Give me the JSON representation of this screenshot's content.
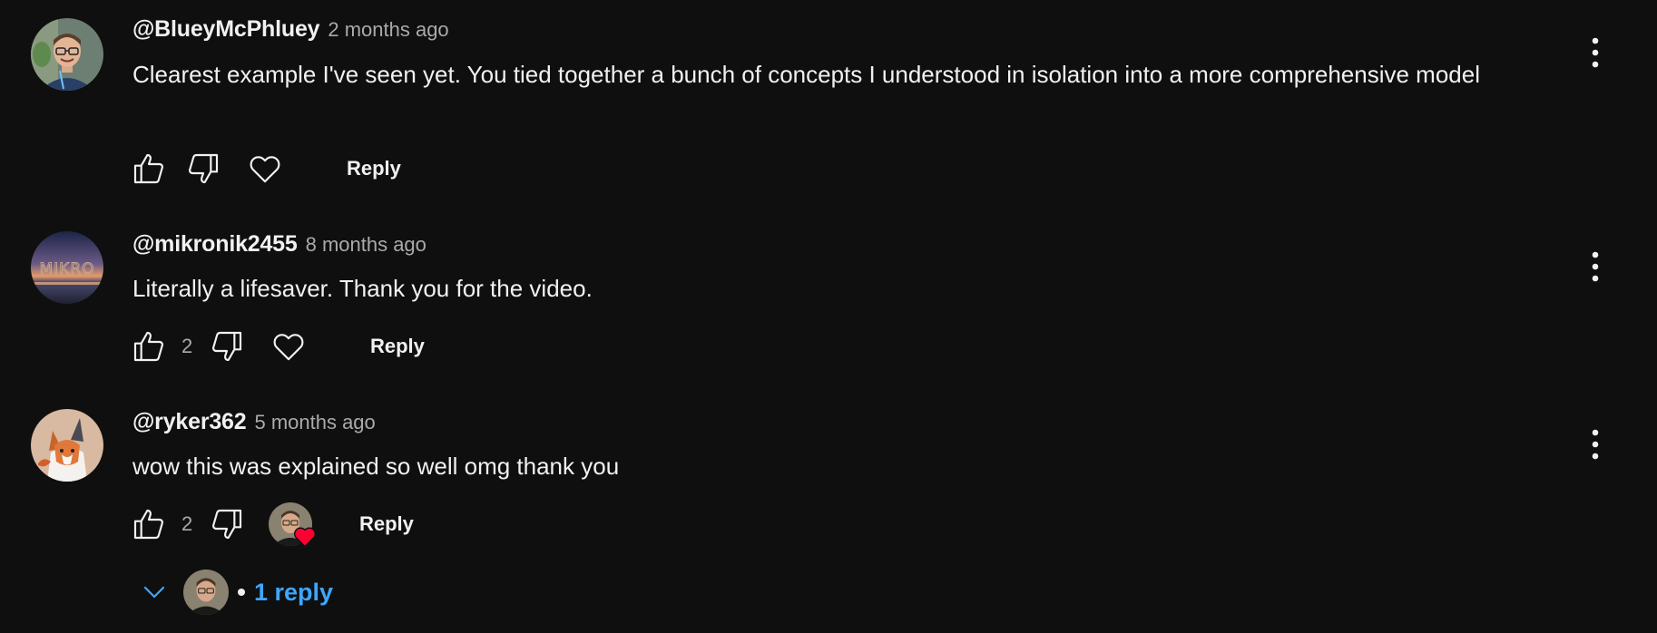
{
  "comments": [
    {
      "author": "@BlueyMcPhluey",
      "time": "2 months ago",
      "text": "Clearest example I've seen yet. You tied together a bunch of concepts I understood in isolation into a more comprehensive model",
      "likes": "",
      "reply_label": "Reply",
      "avatar_icon": "avatar-man-glasses"
    },
    {
      "author": "@mikronik2455",
      "time": "8 months ago",
      "text": "Literally a lifesaver. Thank you for the video.",
      "likes": "2",
      "reply_label": "Reply",
      "avatar_icon": "avatar-sunset-mikro"
    },
    {
      "author": "@ryker362",
      "time": "5 months ago",
      "text": "wow this was explained so well omg thank you",
      "likes": "2",
      "reply_label": "Reply",
      "avatar_icon": "avatar-fox-cartoon",
      "creator_hearted": true
    }
  ],
  "replies_toggle": {
    "label": "1 reply"
  },
  "avatar_lettering": "MIKRO",
  "colors": {
    "background": "#0f0f0f",
    "text": "#f1f1f1",
    "secondary": "#aaaaaa",
    "link": "#3ea6ff",
    "heart": "#ff0033"
  }
}
